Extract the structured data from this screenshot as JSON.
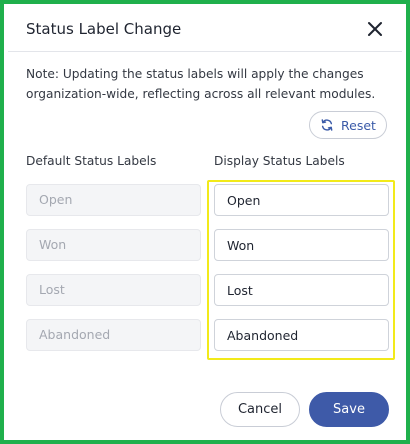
{
  "dialog": {
    "title": "Status Label Change",
    "note": "Note: Updating the status labels will apply the changes organization-wide, reflecting across all relevant modules.",
    "reset_label": "Reset",
    "cancel_label": "Cancel",
    "save_label": "Save"
  },
  "columns": {
    "default_header": "Default Status Labels",
    "display_header": "Display Status Labels"
  },
  "rows": [
    {
      "default": "Open",
      "display": "Open"
    },
    {
      "default": "Won",
      "display": "Won"
    },
    {
      "default": "Lost",
      "display": "Lost"
    },
    {
      "default": "Abandoned",
      "display": "Abandoned"
    }
  ],
  "icons": {
    "close": "close-icon",
    "reset": "refresh-icon"
  },
  "colors": {
    "frame_border": "#1fb04c",
    "highlight_border": "#f2ea1a",
    "primary": "#3e5aa8"
  }
}
